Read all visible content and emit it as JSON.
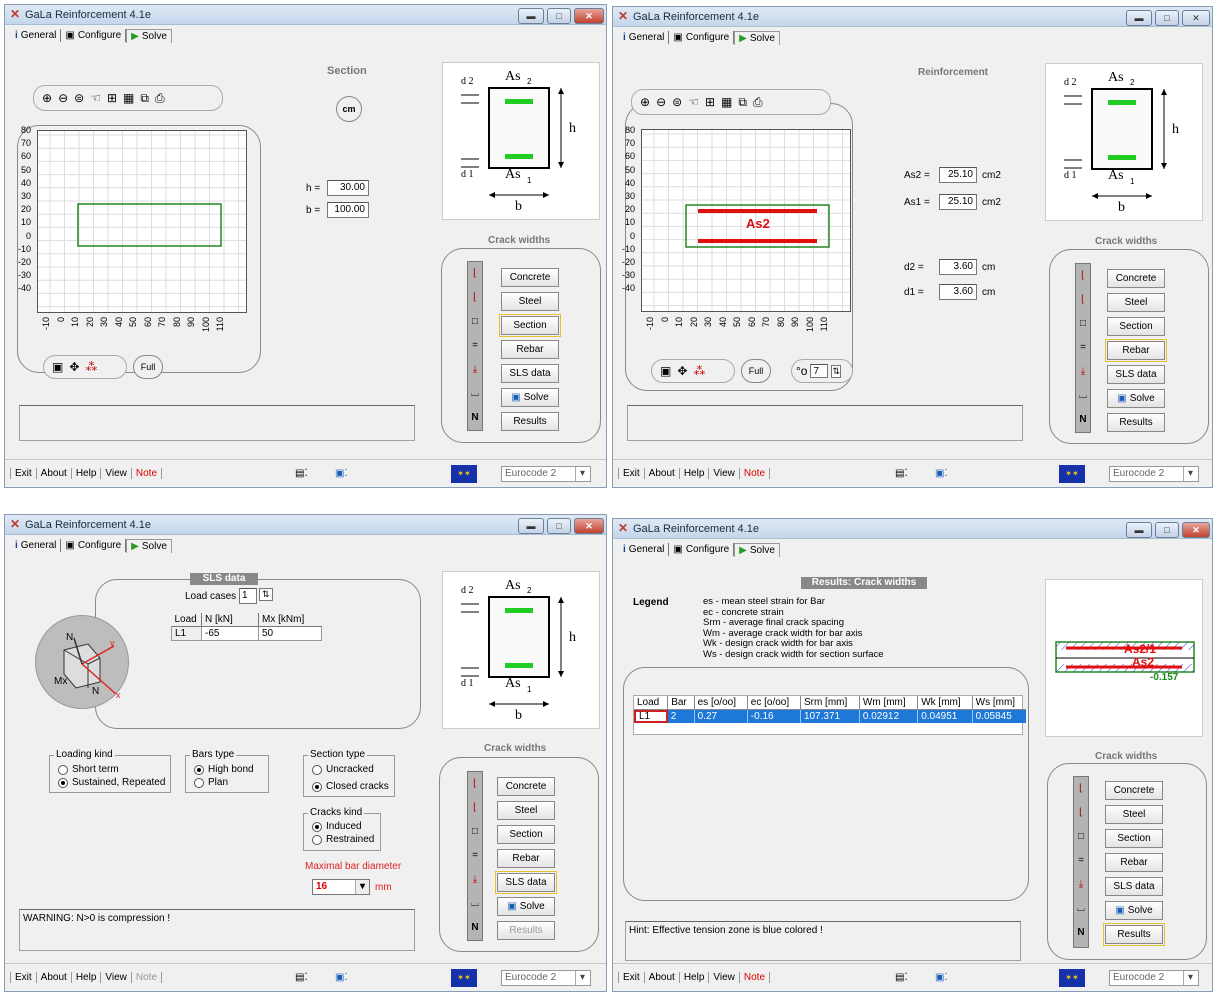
{
  "app_title": "GaLa Reinforcement 4.1e",
  "tabs": {
    "general": "General",
    "configure": "Configure",
    "solve": "Solve"
  },
  "side_buttons": {
    "concrete": "Concrete",
    "steel": "Steel",
    "section": "Section",
    "rebar": "Rebar",
    "sls": "SLS data",
    "solve": "Solve",
    "results": "Results"
  },
  "crack_widths": "Crack widths",
  "footer": {
    "exit": "Exit",
    "about": "About",
    "help": "Help",
    "view": "View",
    "note": "Note",
    "code": "Eurocode 2"
  },
  "diagram": {
    "d2": "d 2",
    "d1": "d 1",
    "as": "As",
    "s2": "2",
    "s1": "1",
    "h": "h",
    "b": "b"
  },
  "y_ticks": [
    "80",
    "70",
    "60",
    "50",
    "40",
    "30",
    "20",
    "10",
    "0",
    "-10",
    "-20",
    "-30",
    "-40"
  ],
  "x_ticks": [
    "-10",
    "0",
    "10",
    "20",
    "30",
    "40",
    "50",
    "60",
    "70",
    "80",
    "90",
    "100",
    "110"
  ],
  "w1": {
    "heading": "Section",
    "unit": "cm",
    "h_label": "h =",
    "h_value": "30.00",
    "b_label": "b =",
    "b_value": "100.00",
    "full": "Full"
  },
  "w2": {
    "heading": "Reinforcement",
    "as2_label": "As2 =",
    "as2_value": "25.10",
    "as2_unit": "cm2",
    "as1_label": "As1 =",
    "as1_value": "25.10",
    "as1_unit": "cm2",
    "d2_label": "d2 =",
    "d2_value": "3.60",
    "d2_unit": "cm",
    "d1_label": "d1 =",
    "d1_value": "3.60",
    "d1_unit": "cm",
    "full": "Full",
    "spin_value": "7",
    "plot_label": "As2"
  },
  "w3": {
    "heading": "SLS data",
    "load_cases_label": "Load cases",
    "load_cases_value": "1",
    "table_headers": [
      "Load",
      "N [kN]",
      "Mx [kNm]"
    ],
    "table_row": [
      "L1",
      "-65",
      "50"
    ],
    "loading_kind": "Loading kind",
    "short_term": "Short term",
    "sustained": "Sustained, Repeated",
    "bars_type": "Bars type",
    "high_bond": "High bond",
    "plan": "Plan",
    "section_type": "Section type",
    "uncracked": "Uncracked",
    "closed_cracks": "Closed cracks",
    "cracks_kind": "Cracks kind",
    "induced": "Induced",
    "restrained": "Restrained",
    "max_bar": "Maximal bar diameter",
    "bar_value": "16",
    "bar_unit": "mm",
    "axes": {
      "n": "N",
      "y": "y",
      "mx": "Mx",
      "x": "x",
      "n2": "N"
    },
    "warning": "WARNING:  N>0 is compression !"
  },
  "w4": {
    "heading": "Results: Crack widths",
    "legend_title": "Legend",
    "legend": [
      "es  - mean steel strain for Bar",
      "ec  - concrete strain",
      "Srm - average final crack spacing",
      "Wm  - average crack width for bar axis",
      "Wk  - design crack width for bar axis",
      "Ws  - design crack width for section surface"
    ],
    "table_headers": [
      "Load",
      "Bar",
      "es [o/oo]",
      "ec [o/oo]",
      "Srm  [mm]",
      "Wm  [mm]",
      "Wk  [mm]",
      "Ws  [mm]"
    ],
    "table_row": [
      "L1",
      "2",
      "0.27",
      "-0.16",
      "107.371",
      "0.02912",
      "0.04951",
      "0.05845"
    ],
    "diag_labels": {
      "top": "As2/1",
      "bot": "As2",
      "value": "-0.157"
    },
    "hint": "Hint: Effective tension zone is blue colored !"
  },
  "colors": {
    "bar": "#22cc22",
    "section": "#228822",
    "rebar_red": "#e01010",
    "highlight": "#1e78d8"
  }
}
